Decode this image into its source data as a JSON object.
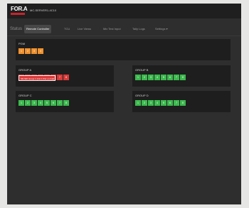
{
  "header": {
    "device_name": "MC-SERVER1-4C10"
  },
  "nav": {
    "status_label": "Status",
    "tabs": [
      {
        "label": "Remote Controller",
        "active": true
      },
      {
        "label": "TCU",
        "active": false
      },
      {
        "label": "Live Views",
        "active": false
      },
      {
        "label": "Mix Test Input",
        "active": false
      },
      {
        "label": "Tally Logs",
        "active": false
      },
      {
        "label": "Settings ▾",
        "active": false
      }
    ]
  },
  "groups": {
    "pgm": {
      "title": "PGM",
      "cells": [
        "1",
        "2",
        "3",
        "4"
      ]
    },
    "group_a": {
      "title": "GROUP A",
      "cells": [
        "1",
        "2",
        "3",
        "4",
        "5",
        "6",
        "7",
        "8"
      ]
    },
    "group_b": {
      "title": "GROUP B",
      "cells": [
        "1",
        "2",
        "3",
        "4",
        "5",
        "6",
        "7",
        "8"
      ]
    },
    "group_c": {
      "title": "GROUP C",
      "cells": [
        "1",
        "2",
        "3",
        "4",
        "5",
        "6",
        "7",
        "8"
      ]
    },
    "group_d": {
      "title": "GROUP D",
      "cells": [
        "1",
        "2",
        "3",
        "4",
        "5",
        "6",
        "7",
        "8"
      ]
    }
  },
  "tooltip": {
    "text": "SD-SDI Group 1 (CH 1 Pwr on Fail) 1"
  },
  "colors": {
    "green": "#3cb94e",
    "red": "#d83a3a",
    "orange": "#f0922f",
    "brand_red": "#c8232c"
  }
}
